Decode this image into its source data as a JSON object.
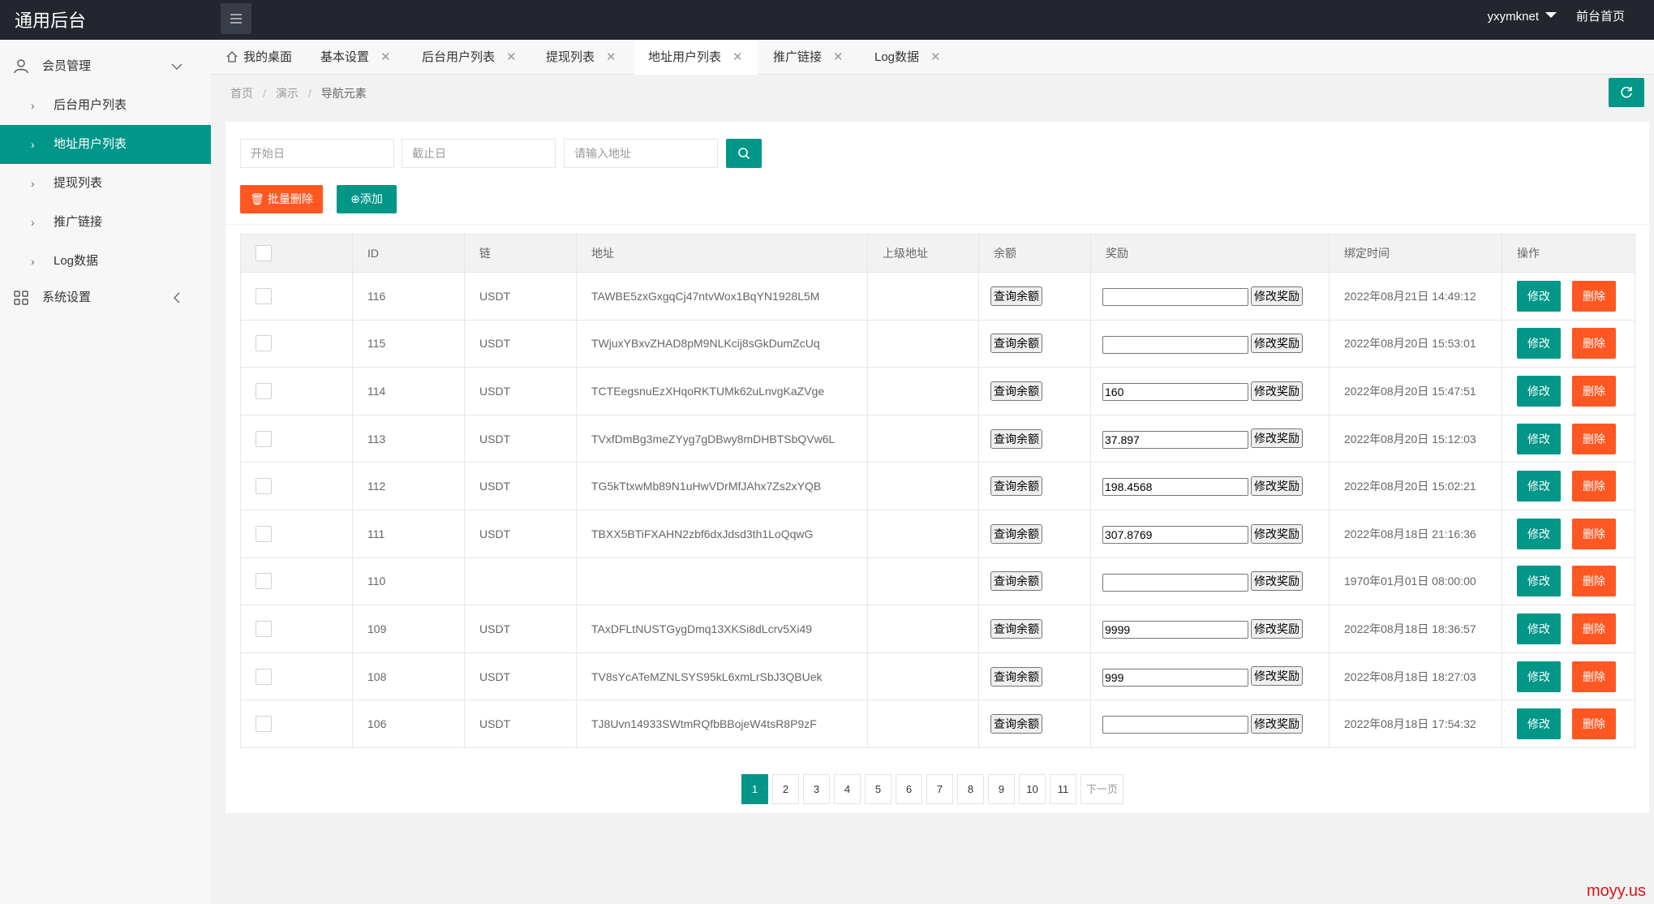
{
  "header": {
    "logo": "通用后台",
    "username": "yxymknet",
    "front_link": "前台首页"
  },
  "sidebar": {
    "groups": [
      {
        "label": "会员管理",
        "icon": "user-icon",
        "expanded": true,
        "items": [
          {
            "label": "后台用户列表"
          },
          {
            "label": "地址用户列表",
            "active": true
          },
          {
            "label": "提现列表"
          },
          {
            "label": "推广链接"
          },
          {
            "label": "Log数据"
          }
        ]
      },
      {
        "label": "系统设置",
        "icon": "grid-icon",
        "expanded": false
      }
    ]
  },
  "tabs": [
    {
      "label": "我的桌面"
    },
    {
      "label": "基本设置"
    },
    {
      "label": "后台用户列表"
    },
    {
      "label": "提现列表"
    },
    {
      "label": "地址用户列表",
      "active": true
    },
    {
      "label": "推广链接"
    },
    {
      "label": "Log数据"
    }
  ],
  "breadcrumb": [
    "首页",
    "演示",
    "导航元素"
  ],
  "filters": {
    "start_placeholder": "开始日",
    "end_placeholder": "截止日",
    "address_placeholder": "请输入地址"
  },
  "actions": {
    "batch_delete": "批量删除",
    "add": "添加"
  },
  "table": {
    "columns": [
      "ID",
      "链",
      "地址",
      "上级地址",
      "余额",
      "奖励",
      "绑定时间",
      "操作"
    ],
    "query_label": "查询余额",
    "modify_reward_label": "修改奖励",
    "edit_label": "修改",
    "delete_label": "删除",
    "rows": [
      {
        "id": "116",
        "chain": "USDT",
        "address": "TAWBE5zxGxgqCj47ntvWox1BqYN1928L5M",
        "parent": "",
        "reward": "",
        "time": "2022年08月21日 14:49:12"
      },
      {
        "id": "115",
        "chain": "USDT",
        "address": "TWjuxYBxvZHAD8pM9NLKcij8sGkDumZcUq",
        "parent": "",
        "reward": "",
        "time": "2022年08月20日 15:53:01"
      },
      {
        "id": "114",
        "chain": "USDT",
        "address": "TCTEegsnuEzXHqoRKTUMk62uLnvgKaZVge",
        "parent": "",
        "reward": "160",
        "time": "2022年08月20日 15:47:51"
      },
      {
        "id": "113",
        "chain": "USDT",
        "address": "TVxfDmBg3meZYyg7gDBwy8mDHBTSbQVw6L",
        "parent": "",
        "reward": "37.897",
        "time": "2022年08月20日 15:12:03"
      },
      {
        "id": "112",
        "chain": "USDT",
        "address": "TG5kTtxwMb89N1uHwVDrMfJAhx7Zs2xYQB",
        "parent": "",
        "reward": "198.4568",
        "time": "2022年08月20日 15:02:21"
      },
      {
        "id": "111",
        "chain": "USDT",
        "address": "TBXX5BTiFXAHN2zbf6dxJdsd3th1LoQqwG",
        "parent": "",
        "reward": "307.8769",
        "time": "2022年08月18日 21:16:36"
      },
      {
        "id": "110",
        "chain": "",
        "address": "",
        "parent": "",
        "reward": "",
        "time": "1970年01月01日 08:00:00"
      },
      {
        "id": "109",
        "chain": "USDT",
        "address": "TAxDFLtNUSTGygDmq13XKSi8dLcrv5Xi49",
        "parent": "",
        "reward": "9999",
        "time": "2022年08月18日 18:36:57"
      },
      {
        "id": "108",
        "chain": "USDT",
        "address": "TV8sYcATeMZNLSYS95kL6xmLrSbJ3QBUek",
        "parent": "",
        "reward": "999",
        "time": "2022年08月18日 18:27:03"
      },
      {
        "id": "106",
        "chain": "USDT",
        "address": "TJ8Uvn14933SWtmRQfbBBojeW4tsR8P9zF",
        "parent": "",
        "reward": "",
        "time": "2022年08月18日 17:54:32"
      }
    ]
  },
  "pagination": {
    "pages": [
      "1",
      "2",
      "3",
      "4",
      "5",
      "6",
      "7",
      "8",
      "9",
      "10",
      "11"
    ],
    "current": "1",
    "next_label": "下一页"
  },
  "watermark": "moyy.us",
  "colors": {
    "header_bg": "#23262e",
    "accent": "#009688",
    "danger": "#ff5722"
  }
}
